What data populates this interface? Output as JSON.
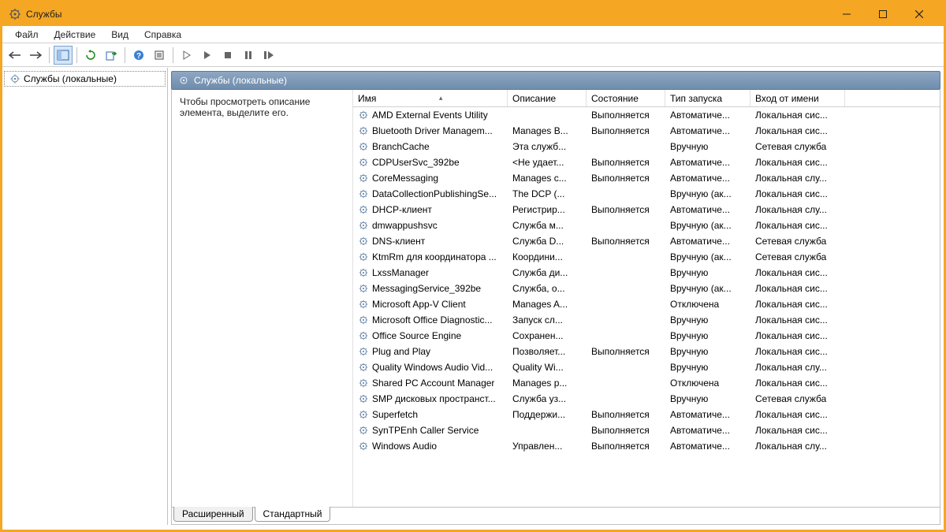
{
  "window": {
    "title": "Службы"
  },
  "menu": {
    "file": "Файл",
    "action": "Действие",
    "view": "Вид",
    "help": "Справка"
  },
  "tree": {
    "root": "Службы (локальные)"
  },
  "header": {
    "caption": "Службы (локальные)"
  },
  "desc": {
    "hint": "Чтобы просмотреть описание элемента, выделите его."
  },
  "columns": {
    "name": "Имя",
    "description": "Описание",
    "state": "Состояние",
    "startup": "Тип запуска",
    "logon": "Вход от имени"
  },
  "tabs": {
    "extended": "Расширенный",
    "standard": "Стандартный"
  },
  "services": [
    {
      "name": "AMD External Events Utility",
      "desc": "",
      "state": "Выполняется",
      "start": "Автоматиче...",
      "logon": "Локальная сис..."
    },
    {
      "name": "Bluetooth Driver Managem...",
      "desc": "Manages B...",
      "state": "Выполняется",
      "start": "Автоматиче...",
      "logon": "Локальная сис..."
    },
    {
      "name": "BranchCache",
      "desc": "Эта служб...",
      "state": "",
      "start": "Вручную",
      "logon": "Сетевая служба"
    },
    {
      "name": "CDPUserSvc_392be",
      "desc": "<Не удает...",
      "state": "Выполняется",
      "start": "Автоматиче...",
      "logon": "Локальная сис..."
    },
    {
      "name": "CoreMessaging",
      "desc": "Manages c...",
      "state": "Выполняется",
      "start": "Автоматиче...",
      "logon": "Локальная слу..."
    },
    {
      "name": "DataCollectionPublishingSe...",
      "desc": "The DCP (...",
      "state": "",
      "start": "Вручную (ак...",
      "logon": "Локальная сис..."
    },
    {
      "name": "DHCP-клиент",
      "desc": "Регистрир...",
      "state": "Выполняется",
      "start": "Автоматиче...",
      "logon": "Локальная слу..."
    },
    {
      "name": "dmwappushsvc",
      "desc": "Служба м...",
      "state": "",
      "start": "Вручную (ак...",
      "logon": "Локальная сис..."
    },
    {
      "name": "DNS-клиент",
      "desc": "Служба D...",
      "state": "Выполняется",
      "start": "Автоматиче...",
      "logon": "Сетевая служба"
    },
    {
      "name": "KtmRm для координатора ...",
      "desc": "Координи...",
      "state": "",
      "start": "Вручную (ак...",
      "logon": "Сетевая служба"
    },
    {
      "name": "LxssManager",
      "desc": "Служба ди...",
      "state": "",
      "start": "Вручную",
      "logon": "Локальная сис..."
    },
    {
      "name": "MessagingService_392be",
      "desc": "Служба, о...",
      "state": "",
      "start": "Вручную (ак...",
      "logon": "Локальная сис..."
    },
    {
      "name": "Microsoft App-V Client",
      "desc": "Manages A...",
      "state": "",
      "start": "Отключена",
      "logon": "Локальная сис..."
    },
    {
      "name": "Microsoft Office Diagnostic...",
      "desc": "Запуск сл...",
      "state": "",
      "start": "Вручную",
      "logon": "Локальная сис..."
    },
    {
      "name": "Office Source Engine",
      "desc": "Сохранен...",
      "state": "",
      "start": "Вручную",
      "logon": "Локальная сис..."
    },
    {
      "name": "Plug and Play",
      "desc": "Позволяет...",
      "state": "Выполняется",
      "start": "Вручную",
      "logon": "Локальная сис..."
    },
    {
      "name": "Quality Windows Audio Vid...",
      "desc": "Quality Wi...",
      "state": "",
      "start": "Вручную",
      "logon": "Локальная слу..."
    },
    {
      "name": "Shared PC Account Manager",
      "desc": "Manages p...",
      "state": "",
      "start": "Отключена",
      "logon": "Локальная сис..."
    },
    {
      "name": "SMP дисковых пространст...",
      "desc": "Служба уз...",
      "state": "",
      "start": "Вручную",
      "logon": "Сетевая служба"
    },
    {
      "name": "Superfetch",
      "desc": "Поддержи...",
      "state": "Выполняется",
      "start": "Автоматиче...",
      "logon": "Локальная сис..."
    },
    {
      "name": "SynTPEnh Caller Service",
      "desc": "",
      "state": "Выполняется",
      "start": "Автоматиче...",
      "logon": "Локальная сис..."
    },
    {
      "name": "Windows Audio",
      "desc": "Управлен...",
      "state": "Выполняется",
      "start": "Автоматиче...",
      "logon": "Локальная слу..."
    }
  ]
}
